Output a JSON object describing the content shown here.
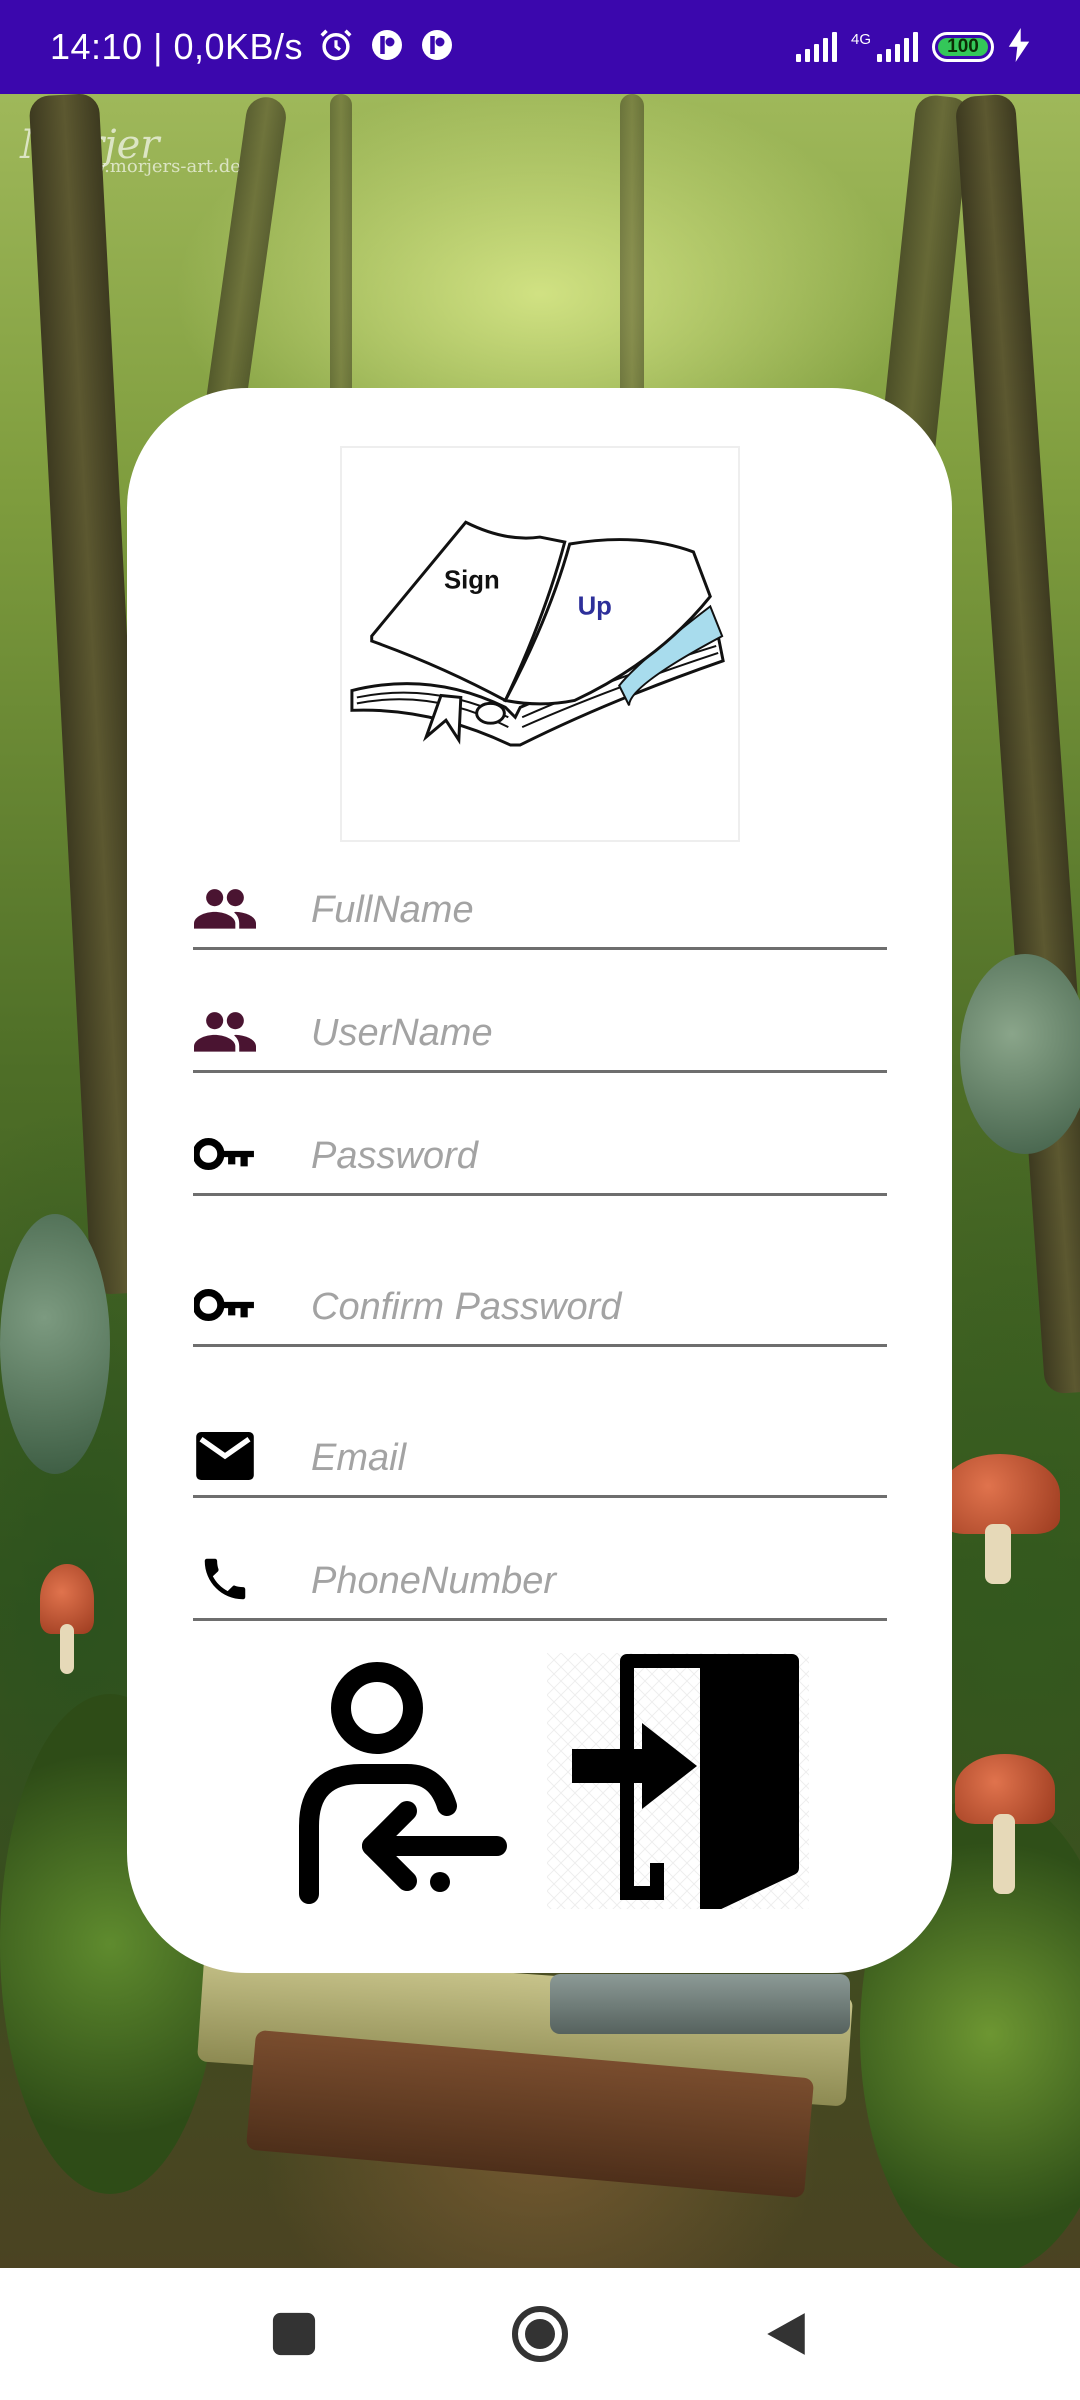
{
  "status_bar": {
    "time": "14:10 | 0,0KB/s",
    "network": "4G",
    "battery": "100",
    "icons": [
      "alarm-icon",
      "notification-icon",
      "notification-icon",
      "signal-icon",
      "signal-icon",
      "charging-icon"
    ]
  },
  "background": {
    "watermark_signature": "Morjer",
    "watermark_url": "www.morjers-art.de"
  },
  "logo": {
    "left_page_text": "Sign",
    "right_page_text": "Up"
  },
  "form": {
    "fullname": {
      "placeholder": "FullName",
      "value": "",
      "icon": "people-icon"
    },
    "username": {
      "placeholder": "UserName",
      "value": "",
      "icon": "people-icon"
    },
    "password": {
      "placeholder": "Password",
      "value": "",
      "icon": "key-icon"
    },
    "confirm_password": {
      "placeholder": "Confirm Password",
      "value": "",
      "icon": "key-icon"
    },
    "email": {
      "placeholder": "Email",
      "value": "",
      "icon": "mail-icon"
    },
    "phone": {
      "placeholder": "PhoneNumber",
      "value": "",
      "icon": "phone-icon"
    }
  },
  "actions": {
    "register_icon": "user-register-icon",
    "login_icon": "login-door-icon"
  },
  "nav_bar": {
    "icons": [
      "recents-square-icon",
      "home-circle-icon",
      "back-triangle-icon"
    ]
  },
  "colors": {
    "status_bar": "#3b07ad",
    "people_icon": "#4a1431",
    "field_line": "#6e6e6e",
    "placeholder": "#a3a3a3",
    "battery": "#34c759"
  }
}
